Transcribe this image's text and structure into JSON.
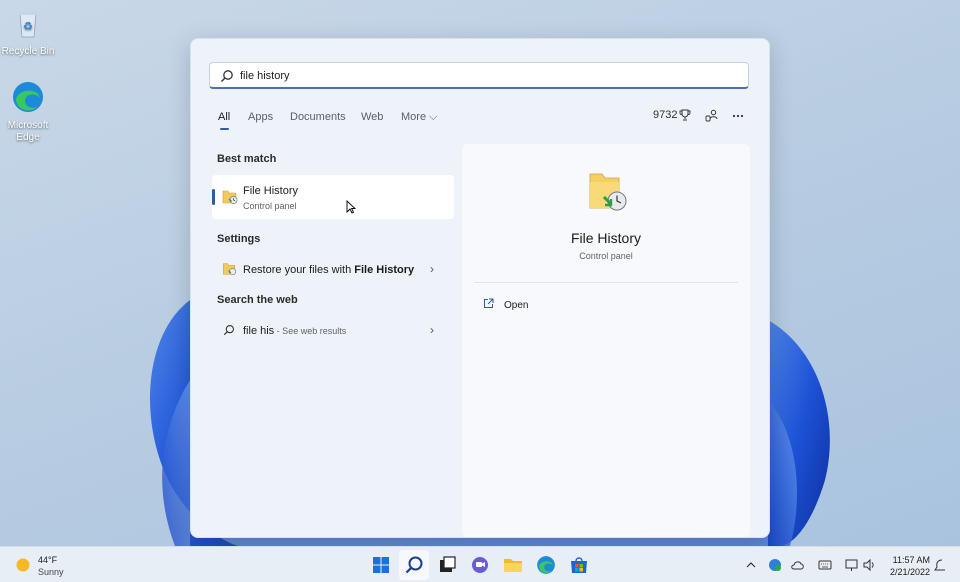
{
  "desktop": {
    "icons": [
      {
        "label": "Recycle Bin"
      },
      {
        "label": "Microsoft Edge"
      }
    ]
  },
  "search": {
    "query": "file history",
    "icon": "search-icon"
  },
  "filters": {
    "tabs": [
      "All",
      "Apps",
      "Documents",
      "Web",
      "More ⌵"
    ],
    "active": "All",
    "points": "9732"
  },
  "results": {
    "best_match_title": "Best match",
    "best_match": {
      "title": "File History",
      "subtitle": "Control panel"
    },
    "settings_title": "Settings",
    "settings_item": {
      "prefix": "Restore your files with ",
      "bold": "File History"
    },
    "web_title": "Search the web",
    "web_item": {
      "query": "file his",
      "hint": " - See web results"
    }
  },
  "preview": {
    "title": "File History",
    "subtitle": "Control panel",
    "open_label": "Open"
  },
  "taskbar": {
    "weather_temp": "44°F",
    "weather_desc": "Sunny",
    "time": "11:57 AM",
    "date": "2/21/2022"
  },
  "colors": {
    "accent": "#2f5aa8",
    "panel_bg": "#eef3fa",
    "taskbar_bg": "#e8eef6"
  }
}
